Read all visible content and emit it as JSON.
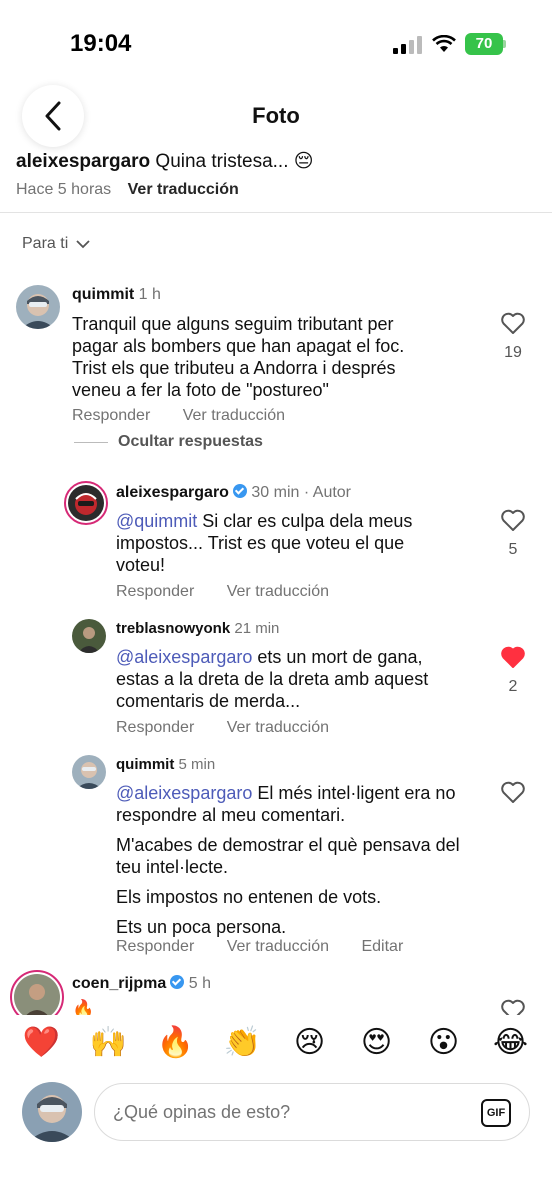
{
  "status_bar": {
    "time": "19:04",
    "battery": "70"
  },
  "header": {
    "title": "Foto"
  },
  "caption": {
    "username": "aleixespargaro",
    "text": "Quina tristesa... 😔",
    "time": "Hace 5 horas",
    "translate": "Ver traducción"
  },
  "sort": {
    "label": "Para ti"
  },
  "comments": [
    {
      "username": "quimmit",
      "time": "1 h",
      "text": "Tranquil que alguns seguim tributant per pagar als bombers que han apagat el foc. Trist els que tributeu a Andorra i després veneu a fer la foto de \"postureo\"",
      "likes": "19",
      "reply": "Responder",
      "translate": "Ver traducción",
      "hide_replies": "Ocultar respuestas"
    },
    {
      "username": "aleixespargaro",
      "time": "30 min · Autor",
      "mention": "@quimmit",
      "text": " Si clar es culpa dela meus impostos... Trist es que voteu el que voteu!",
      "likes": "5",
      "reply": "Responder",
      "translate": "Ver traducción"
    },
    {
      "username": "treblasnowyonk",
      "time": "21 min",
      "mention": "@aleixespargaro",
      "text": " ets un mort de gana, estas a la dreta de la dreta amb aquest comentaris de merda...",
      "likes": "2",
      "reply": "Responder",
      "translate": "Ver traducción"
    },
    {
      "username": "quimmit",
      "time": "5 min",
      "mention": "@aleixespargaro",
      "text": " El més intel·ligent era no respondre al meu comentari.",
      "para2": "M'acabes de demostrar el què pensava del teu intel·lecte.",
      "para3": "Els impostos no entenen de vots.",
      "para4": "Ets un poca persona.",
      "reply": "Responder",
      "translate": "Ver traducción",
      "edit": "Editar"
    },
    {
      "username": "coen_rijpma",
      "time": "5 h",
      "text": "🔥"
    }
  ],
  "reactions": [
    "❤️",
    "🙌",
    "🔥",
    "👏",
    "😢",
    "😍",
    "😮",
    "😂"
  ],
  "input": {
    "placeholder": "¿Qué opinas de esto?",
    "gif": "GIF"
  },
  "colors": {
    "mention": "#4d5bb8",
    "like_active": "#ff3040",
    "verified": "#3897f0",
    "battery": "#36c34a"
  }
}
